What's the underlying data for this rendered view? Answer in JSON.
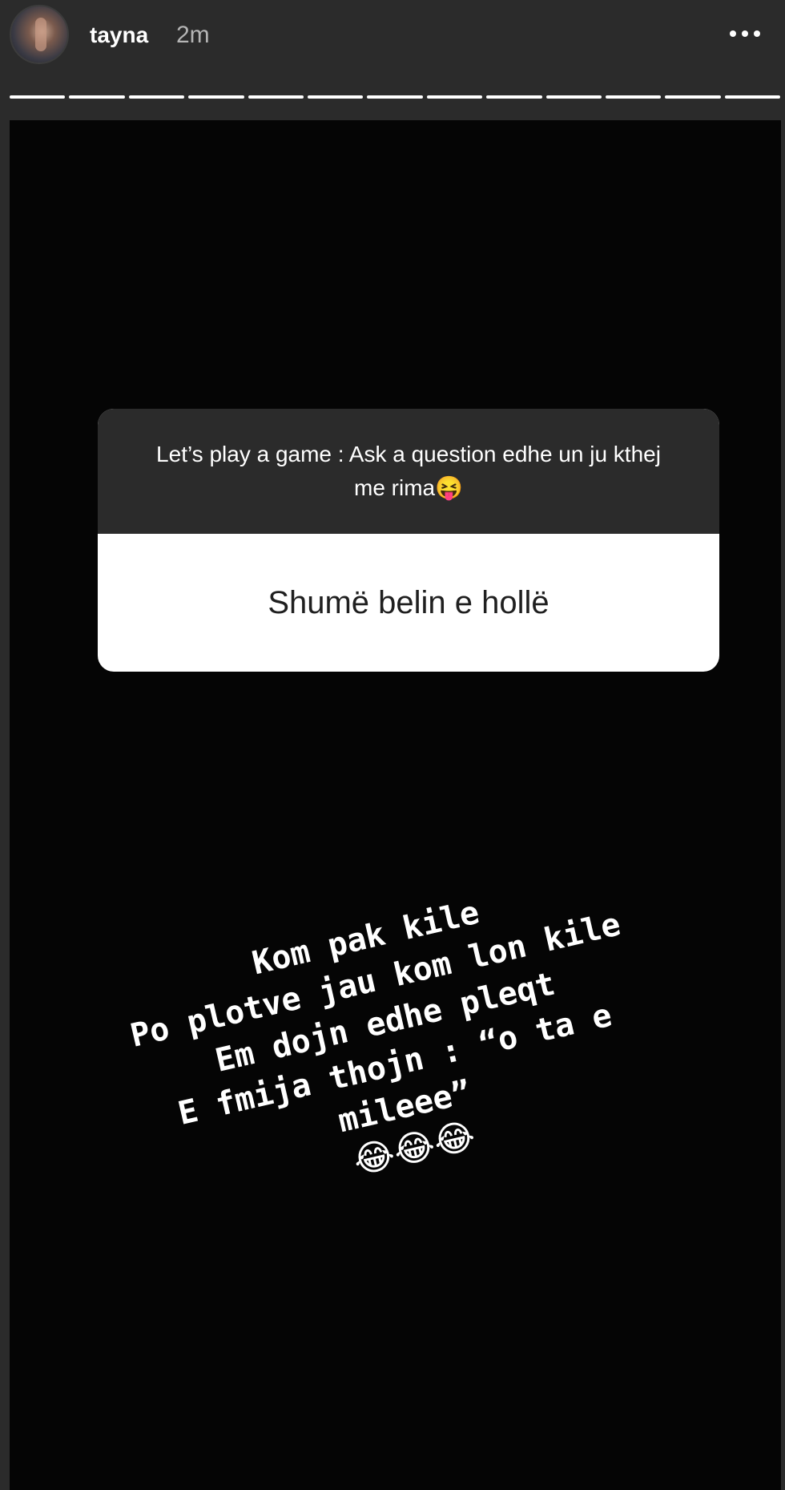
{
  "header": {
    "username": "tayna",
    "time": "2m",
    "more_icon": "more-horizontal-icon",
    "progress_segments": 13
  },
  "question_sticker": {
    "prompt": "Let’s play a game : Ask a question edhe un ju kthej me rima😝",
    "answer": "Shumë belin e hollë"
  },
  "overlay_text": {
    "lines": [
      "Kom pak kile",
      "Po plotve jau kom lon kile",
      "Em dojn edhe pleqt",
      "E fmija thojn : “o ta e",
      "mileee”"
    ],
    "emojis": "😂😂😂"
  },
  "colors": {
    "background": "#2b2b2b",
    "story_bg": "#050505",
    "text_primary": "#ffffff",
    "text_secondary": "#b5b5b5"
  }
}
